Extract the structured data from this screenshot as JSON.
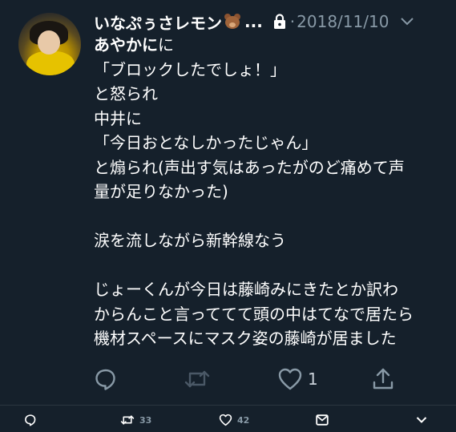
{
  "tweet": {
    "display_name": "いなぷぅさレモン",
    "name_suffix": "...",
    "separator": "·",
    "date": "2018/11/10",
    "text_first_bold": "あやかに",
    "text_lines": [
      "に",
      "「ブロックしたでしょ！」",
      "と怒られ",
      "中井に",
      "「今日おとなしかったじゃん」",
      "と煽られ(声出す気はあったがのど痛めて声",
      "量が足りなかった)",
      "",
      "涙を流しながら新幹線なう",
      "",
      "じょーくんが今日は藤崎みにきたとか訳わ",
      "からんこと言っててて頭の中はてなで居たら",
      "機材スペースにマスク姿の藤崎が居ました"
    ],
    "actions": {
      "reply_count": "",
      "retweet_count": "",
      "like_count": "1",
      "share_count": ""
    }
  },
  "footer": {
    "reply_count": "",
    "retweet_count": "33",
    "like_count": "42"
  },
  "colors": {
    "background": "#15202b",
    "text": "#ffffff",
    "muted": "#8899a6"
  },
  "icons": [
    "bear-emoji-icon",
    "lock-icon",
    "chevron-down-icon",
    "reply-icon",
    "retweet-icon",
    "like-icon",
    "share-icon",
    "mail-icon"
  ]
}
